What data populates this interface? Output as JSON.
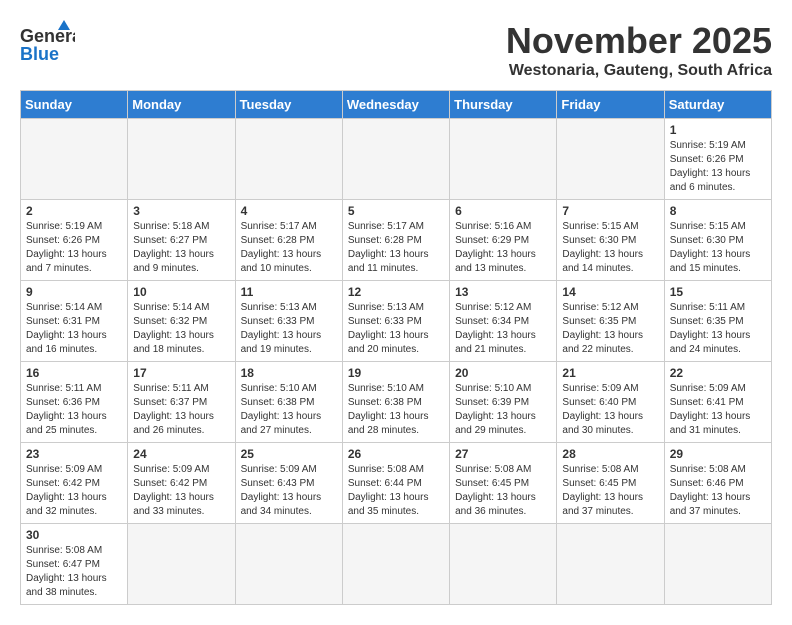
{
  "header": {
    "logo_general": "General",
    "logo_blue": "Blue",
    "month": "November 2025",
    "location": "Westonaria, Gauteng, South Africa"
  },
  "days_of_week": [
    "Sunday",
    "Monday",
    "Tuesday",
    "Wednesday",
    "Thursday",
    "Friday",
    "Saturday"
  ],
  "weeks": [
    [
      {
        "day": "",
        "empty": true
      },
      {
        "day": "",
        "empty": true
      },
      {
        "day": "",
        "empty": true
      },
      {
        "day": "",
        "empty": true
      },
      {
        "day": "",
        "empty": true
      },
      {
        "day": "",
        "empty": true
      },
      {
        "day": "1",
        "info": "Sunrise: 5:19 AM\nSunset: 6:26 PM\nDaylight: 13 hours and 6 minutes."
      }
    ],
    [
      {
        "day": "2",
        "info": "Sunrise: 5:19 AM\nSunset: 6:26 PM\nDaylight: 13 hours and 7 minutes."
      },
      {
        "day": "3",
        "info": "Sunrise: 5:18 AM\nSunset: 6:27 PM\nDaylight: 13 hours and 9 minutes."
      },
      {
        "day": "4",
        "info": "Sunrise: 5:17 AM\nSunset: 6:28 PM\nDaylight: 13 hours and 10 minutes."
      },
      {
        "day": "5",
        "info": "Sunrise: 5:17 AM\nSunset: 6:28 PM\nDaylight: 13 hours and 11 minutes."
      },
      {
        "day": "6",
        "info": "Sunrise: 5:16 AM\nSunset: 6:29 PM\nDaylight: 13 hours and 13 minutes."
      },
      {
        "day": "7",
        "info": "Sunrise: 5:15 AM\nSunset: 6:30 PM\nDaylight: 13 hours and 14 minutes."
      },
      {
        "day": "8",
        "info": "Sunrise: 5:15 AM\nSunset: 6:30 PM\nDaylight: 13 hours and 15 minutes."
      }
    ],
    [
      {
        "day": "9",
        "info": "Sunrise: 5:14 AM\nSunset: 6:31 PM\nDaylight: 13 hours and 16 minutes."
      },
      {
        "day": "10",
        "info": "Sunrise: 5:14 AM\nSunset: 6:32 PM\nDaylight: 13 hours and 18 minutes."
      },
      {
        "day": "11",
        "info": "Sunrise: 5:13 AM\nSunset: 6:33 PM\nDaylight: 13 hours and 19 minutes."
      },
      {
        "day": "12",
        "info": "Sunrise: 5:13 AM\nSunset: 6:33 PM\nDaylight: 13 hours and 20 minutes."
      },
      {
        "day": "13",
        "info": "Sunrise: 5:12 AM\nSunset: 6:34 PM\nDaylight: 13 hours and 21 minutes."
      },
      {
        "day": "14",
        "info": "Sunrise: 5:12 AM\nSunset: 6:35 PM\nDaylight: 13 hours and 22 minutes."
      },
      {
        "day": "15",
        "info": "Sunrise: 5:11 AM\nSunset: 6:35 PM\nDaylight: 13 hours and 24 minutes."
      }
    ],
    [
      {
        "day": "16",
        "info": "Sunrise: 5:11 AM\nSunset: 6:36 PM\nDaylight: 13 hours and 25 minutes."
      },
      {
        "day": "17",
        "info": "Sunrise: 5:11 AM\nSunset: 6:37 PM\nDaylight: 13 hours and 26 minutes."
      },
      {
        "day": "18",
        "info": "Sunrise: 5:10 AM\nSunset: 6:38 PM\nDaylight: 13 hours and 27 minutes."
      },
      {
        "day": "19",
        "info": "Sunrise: 5:10 AM\nSunset: 6:38 PM\nDaylight: 13 hours and 28 minutes."
      },
      {
        "day": "20",
        "info": "Sunrise: 5:10 AM\nSunset: 6:39 PM\nDaylight: 13 hours and 29 minutes."
      },
      {
        "day": "21",
        "info": "Sunrise: 5:09 AM\nSunset: 6:40 PM\nDaylight: 13 hours and 30 minutes."
      },
      {
        "day": "22",
        "info": "Sunrise: 5:09 AM\nSunset: 6:41 PM\nDaylight: 13 hours and 31 minutes."
      }
    ],
    [
      {
        "day": "23",
        "info": "Sunrise: 5:09 AM\nSunset: 6:42 PM\nDaylight: 13 hours and 32 minutes."
      },
      {
        "day": "24",
        "info": "Sunrise: 5:09 AM\nSunset: 6:42 PM\nDaylight: 13 hours and 33 minutes."
      },
      {
        "day": "25",
        "info": "Sunrise: 5:09 AM\nSunset: 6:43 PM\nDaylight: 13 hours and 34 minutes."
      },
      {
        "day": "26",
        "info": "Sunrise: 5:08 AM\nSunset: 6:44 PM\nDaylight: 13 hours and 35 minutes."
      },
      {
        "day": "27",
        "info": "Sunrise: 5:08 AM\nSunset: 6:45 PM\nDaylight: 13 hours and 36 minutes."
      },
      {
        "day": "28",
        "info": "Sunrise: 5:08 AM\nSunset: 6:45 PM\nDaylight: 13 hours and 37 minutes."
      },
      {
        "day": "29",
        "info": "Sunrise: 5:08 AM\nSunset: 6:46 PM\nDaylight: 13 hours and 37 minutes."
      }
    ],
    [
      {
        "day": "30",
        "info": "Sunrise: 5:08 AM\nSunset: 6:47 PM\nDaylight: 13 hours and 38 minutes.",
        "last": true
      },
      {
        "day": "",
        "empty": true,
        "last": true
      },
      {
        "day": "",
        "empty": true,
        "last": true
      },
      {
        "day": "",
        "empty": true,
        "last": true
      },
      {
        "day": "",
        "empty": true,
        "last": true
      },
      {
        "day": "",
        "empty": true,
        "last": true
      },
      {
        "day": "",
        "empty": true,
        "last": true
      }
    ]
  ]
}
